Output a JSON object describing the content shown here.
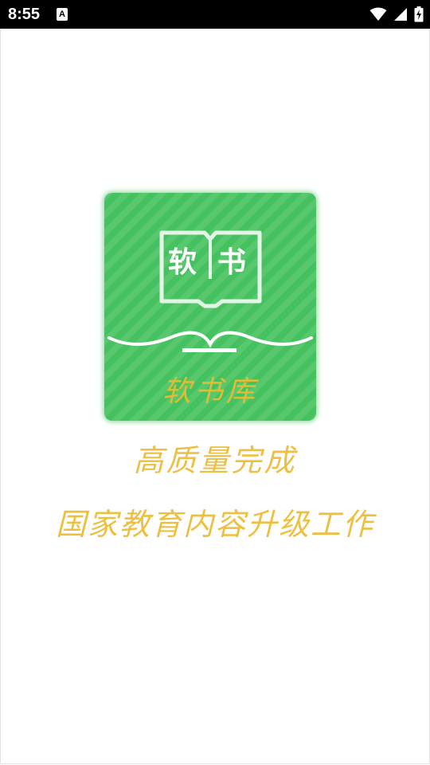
{
  "status_bar": {
    "time": "8:55",
    "notification_icon_letter": "A",
    "icons": [
      "wifi-icon",
      "signal-icon",
      "battery-charging-icon"
    ]
  },
  "splash": {
    "logo": {
      "book_text_left": "软",
      "book_text_right": "书",
      "app_name": "软书库",
      "background_color": "#45c25f",
      "text_color": "#e2bd34"
    },
    "tagline_line1": "高质量完成",
    "tagline_line2": "国家教育内容升级工作",
    "tagline_color": "#edc042"
  }
}
